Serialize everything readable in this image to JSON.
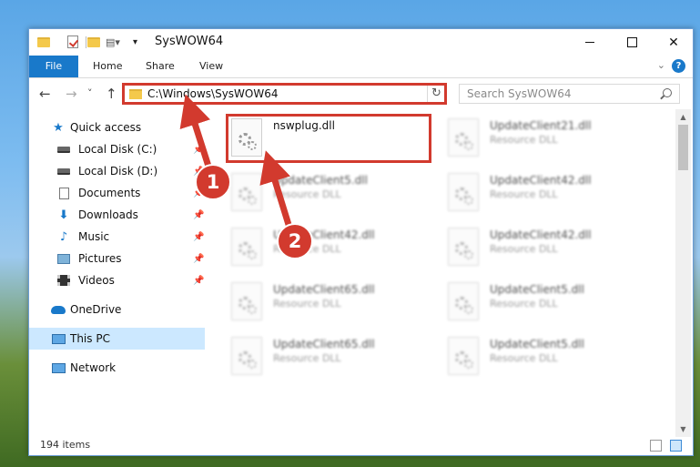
{
  "window": {
    "title": "SysWOW64"
  },
  "ribbon": {
    "file_tab": "File",
    "home_tab": "Home",
    "share_tab": "Share",
    "view_tab": "View",
    "collapse_glyph": "⌄",
    "help_glyph": "?"
  },
  "window_controls": {
    "close_glyph": "✕"
  },
  "nav": {
    "back_glyph": "←",
    "forward_glyph": "→",
    "recent_glyph": "˅",
    "up_glyph": "↑",
    "address": "C:\\Windows\\SysWOW64",
    "dropdown_glyph": "˅",
    "refresh_glyph": "↻",
    "search_placeholder": "Search SysWOW64"
  },
  "sidebar": {
    "pin_glyph": "📌",
    "items": [
      {
        "label": "Quick access",
        "icon": "star-icon"
      },
      {
        "label": "Local Disk (C:)",
        "icon": "disk-icon"
      },
      {
        "label": "Local Disk (D:)",
        "icon": "disk-icon"
      },
      {
        "label": "Documents",
        "icon": "documents-icon"
      },
      {
        "label": "Downloads",
        "icon": "download-arrow-icon"
      },
      {
        "label": "Music",
        "icon": "music-note-icon"
      },
      {
        "label": "Pictures",
        "icon": "pictures-icon"
      },
      {
        "label": "Videos",
        "icon": "video-icon"
      },
      {
        "label": "OneDrive",
        "icon": "cloud-icon"
      },
      {
        "label": "This PC",
        "icon": "computer-icon"
      },
      {
        "label": "Network",
        "icon": "network-icon"
      }
    ]
  },
  "files": [
    {
      "name": "nswplug.dll",
      "type": ""
    },
    {
      "name": "UpdateClient21.dll",
      "type": "Resource DLL"
    },
    {
      "name": "UpdateClient5.dll",
      "type": "Resource DLL"
    },
    {
      "name": "UpdateClient42.dll",
      "type": "Resource DLL"
    },
    {
      "name": "UpdateClient42.dll",
      "type": "Resource DLL"
    },
    {
      "name": "UpdateClient42.dll",
      "type": "Resource DLL"
    },
    {
      "name": "UpdateClient65.dll",
      "type": "Resource DLL"
    },
    {
      "name": "UpdateClient5.dll",
      "type": "Resource DLL"
    },
    {
      "name": "UpdateClient65.dll",
      "type": "Resource DLL"
    },
    {
      "name": "UpdateClient5.dll",
      "type": "Resource DLL"
    }
  ],
  "status": {
    "item_count": "194 items"
  },
  "annotations": {
    "badge1": "1",
    "badge2": "2",
    "color": "#d23a2e"
  }
}
